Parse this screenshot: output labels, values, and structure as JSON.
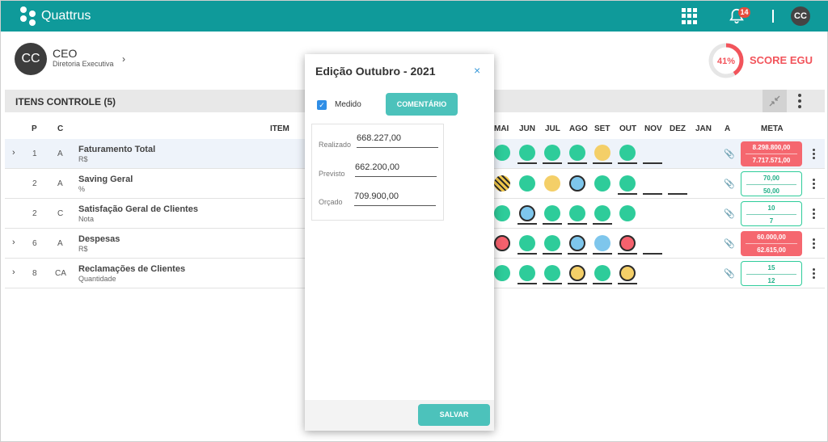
{
  "app": {
    "brand": "Quattrus",
    "notifications": "14",
    "user_initials": "CC"
  },
  "profile": {
    "initials": "CC",
    "role": "CEO",
    "department": "Diretoria Executiva"
  },
  "score": {
    "percent": 41,
    "percent_label": "41%",
    "label": "SCORE EGU"
  },
  "items": {
    "title": "ITENS CONTROLE (5)",
    "headers": {
      "p": "P",
      "c": "C",
      "item": "ITEM",
      "months": [
        "MAI",
        "JUN",
        "JUL",
        "AGO",
        "SET",
        "OUT",
        "NOV",
        "DEZ",
        "JAN"
      ],
      "a": "A",
      "meta": "META"
    },
    "rows": [
      {
        "p": "1",
        "c": "A",
        "name": "Faturamento Total",
        "unit": "R$",
        "meta_top": "8.298.800,00",
        "meta_bottom": "7.717.571,00"
      },
      {
        "p": "2",
        "c": "A",
        "name": "Saving Geral",
        "unit": "%",
        "meta_top": "70,00",
        "meta_bottom": "50,00"
      },
      {
        "p": "2",
        "c": "C",
        "name": "Satisfação Geral de Clientes",
        "unit": "Nota",
        "meta_top": "10",
        "meta_bottom": "7"
      },
      {
        "p": "6",
        "c": "A",
        "name": "Despesas",
        "unit": "R$",
        "meta_top": "60.000,00",
        "meta_bottom": "62.615,00"
      },
      {
        "p": "8",
        "c": "CA",
        "name": "Reclamações de Clientes",
        "unit": "Quantidade",
        "meta_top": "15",
        "meta_bottom": "12"
      }
    ]
  },
  "modal": {
    "title": "Edição Outubro - 2021",
    "close": "×",
    "checkbox_label": "Medido",
    "comment_button": "COMENTÁRIO",
    "fields": [
      {
        "label": "Realizado",
        "value": "668.227,00"
      },
      {
        "label": "Previsto",
        "value": "662.200,00"
      },
      {
        "label": "Orçado",
        "value": "709.900,00"
      }
    ],
    "save_button": "SALVAR"
  },
  "colors": {
    "header": "#0f9a9a",
    "accent": "#4cc2bb",
    "status_green": "#2ecc9a",
    "status_yellow": "#f4cf68",
    "status_blue": "#7ec6ec",
    "status_red": "#f5616d",
    "score_red": "#f2545b"
  }
}
